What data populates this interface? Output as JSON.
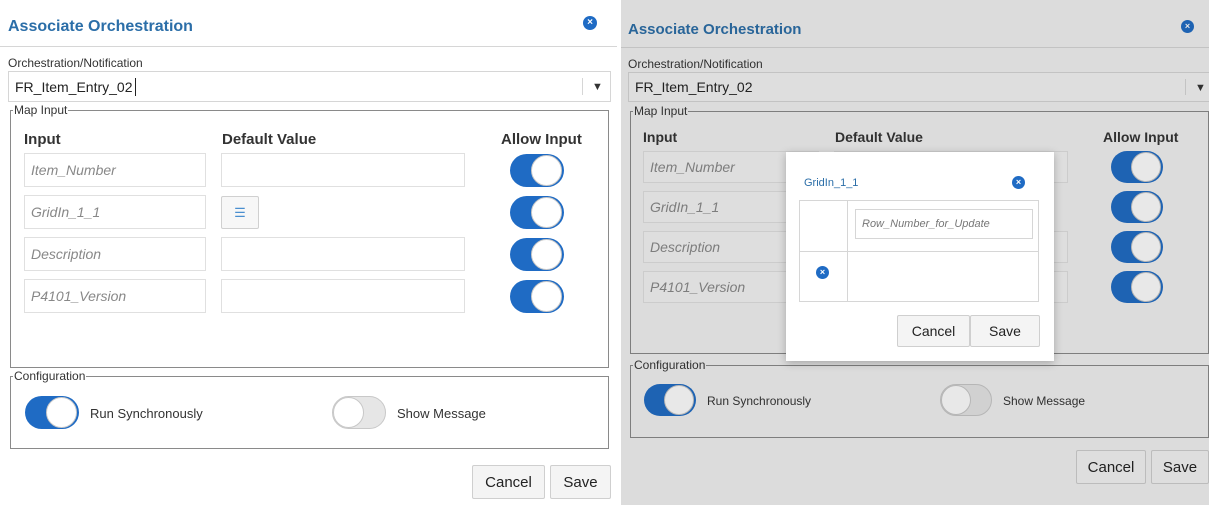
{
  "dialog": {
    "title": "Associate Orchestration",
    "orchestration_label": "Orchestration/Notification",
    "orchestration_value": "FR_Item_Entry_02",
    "map_input_legend": "Map Input",
    "columns": {
      "input": "Input",
      "default_value": "Default Value",
      "allow_input": "Allow Input"
    },
    "rows": [
      {
        "input": "Item_Number",
        "allow_input": true
      },
      {
        "input": "GridIn_1_1",
        "allow_input": true
      },
      {
        "input": "Description",
        "allow_input": true
      },
      {
        "input": "P4101_Version",
        "allow_input": true
      }
    ],
    "configuration_legend": "Configuration",
    "run_synchronously_label": "Run Synchronously",
    "run_synchronously": true,
    "show_message_label": "Show Message",
    "show_message": false,
    "cancel_label": "Cancel",
    "save_label": "Save"
  },
  "grid_popup": {
    "title": "GridIn_1_1",
    "column_field": "Row_Number_for_Update",
    "cancel_label": "Cancel",
    "save_label": "Save"
  },
  "icons": {
    "close": "close-circle-icon",
    "dropdown": "caret-down-icon",
    "list": "list-icon",
    "remove_row": "remove-circle-icon"
  },
  "colors": {
    "accent": "#1f6bc4",
    "title": "#2b6ea8"
  }
}
